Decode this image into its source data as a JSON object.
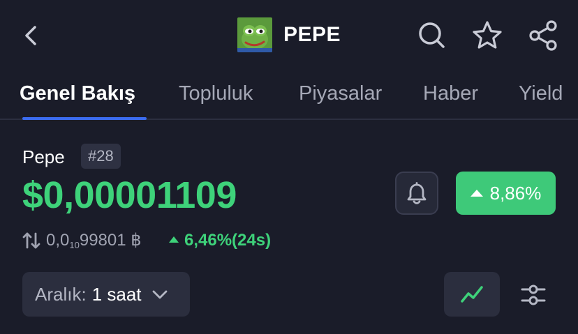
{
  "header": {
    "title": "PEPE",
    "icons": {
      "back": "chevron-left-icon",
      "search": "search-icon",
      "favorite": "star-icon",
      "share": "share-icon"
    }
  },
  "tabs": [
    {
      "label": "Genel Bakış",
      "active": true
    },
    {
      "label": "Topluluk"
    },
    {
      "label": "Piyasalar"
    },
    {
      "label": "Haber"
    },
    {
      "label": "Yield"
    }
  ],
  "coin": {
    "name": "Pepe",
    "rank": "#28",
    "price": "$0,00001109",
    "change_24h": "8,86%",
    "btc_price_prefix": "0,0",
    "btc_price_zeros": "10",
    "btc_price_digits": "99801 ฿",
    "btc_change": "6,46%(24s)"
  },
  "controls": {
    "range_label": "Aralık:",
    "range_value": "1 saat"
  },
  "colors": {
    "background": "#1a1c29",
    "positive": "#3ed27a",
    "accent": "#3b6cf0",
    "badge_green": "#3ec979"
  }
}
